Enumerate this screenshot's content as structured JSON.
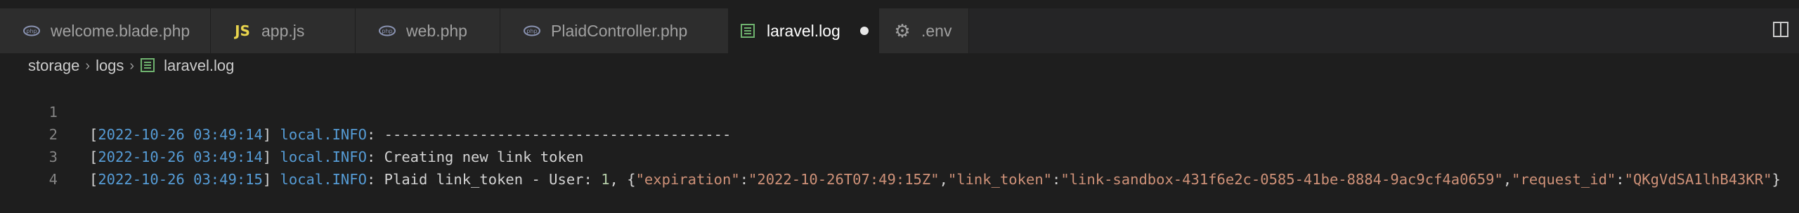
{
  "tabs": [
    {
      "label": "welcome.blade.php",
      "icon": "php-elephant-icon",
      "active": false
    },
    {
      "label": "app.js",
      "icon": "js-icon",
      "active": false
    },
    {
      "label": "web.php",
      "icon": "php-elephant-icon",
      "active": false
    },
    {
      "label": "PlaidController.php",
      "icon": "php-elephant-icon",
      "active": false
    },
    {
      "label": "laravel.log",
      "icon": "log-file-icon",
      "active": true,
      "unsaved": true
    },
    {
      "label": ".env",
      "icon": "gear-icon",
      "active": false
    }
  ],
  "breadcrumb": {
    "items": [
      "storage",
      "logs",
      "laravel.log"
    ]
  },
  "editor": {
    "lines": [
      {
        "number": "1",
        "bracket_open": "[",
        "date": "2022-10-26 03:49:14",
        "bracket_close": "]",
        "level": "local.INFO",
        "message": ": ----------------------------------------"
      },
      {
        "number": "2",
        "bracket_open": "[",
        "date": "2022-10-26 03:49:14",
        "bracket_close": "]",
        "level": "local.INFO",
        "message": ": Creating new link token"
      },
      {
        "number": "3",
        "bracket_open": "[",
        "date": "2022-10-26 03:49:15",
        "bracket_close": "]",
        "level": "local.INFO",
        "message_prefix": ": Plaid link_token - User: ",
        "user_id": "1",
        "after_user": ", {",
        "k1": "\"expiration\"",
        "colon1": ":",
        "v1": "\"2022-10-26T07:49:15Z\"",
        "comma1": ",",
        "k2": "\"link_token\"",
        "colon2": ":",
        "v2": "\"link-sandbox-431f6e2c-0585-41be-8884-9ac9cf4a0659\"",
        "comma2": ",",
        "k3": "\"request_id\"",
        "colon3": ":",
        "v3": "\"QKgVdSA1lhB43KR\"",
        "close": "}"
      },
      {
        "number": "4"
      }
    ]
  },
  "colors": {
    "editor_bg": "#1e1e1e",
    "tabbar_bg": "#252526",
    "keyword_blue": "#569cd6",
    "string_orange": "#ce9178",
    "number_green": "#b5cea8"
  }
}
